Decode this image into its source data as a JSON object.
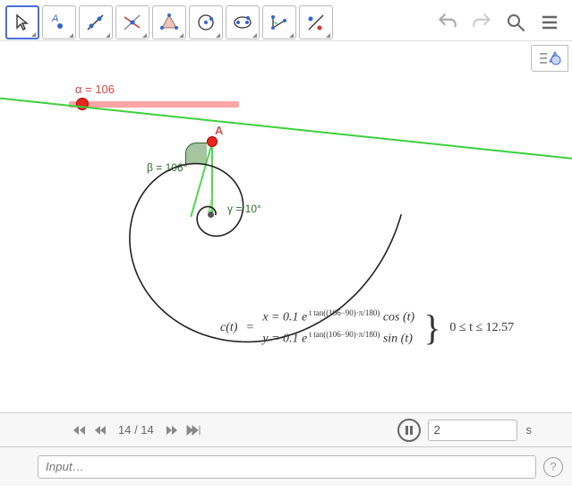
{
  "toolbar": {
    "tools": [
      {
        "name": "move-tool"
      },
      {
        "name": "point-tool"
      },
      {
        "name": "line-tool"
      },
      {
        "name": "perpendicular-tool"
      },
      {
        "name": "polygon-tool"
      },
      {
        "name": "circle-tool"
      },
      {
        "name": "ellipse-tool"
      },
      {
        "name": "angle-tool"
      },
      {
        "name": "reflect-tool"
      }
    ]
  },
  "slider": {
    "alpha_label": "α = 106"
  },
  "points": {
    "A_label": "A"
  },
  "angles": {
    "beta_label": "β = 106°",
    "gamma_label": "γ = 10°"
  },
  "formula": {
    "lhs": "c(t)",
    "eq": "=",
    "row1_pre": "x = 0.1 e",
    "row1_exp": " t tan((106−90)·π/180)",
    "row1_post": " cos (t)",
    "row2_pre": "y = 0.1 e",
    "row2_exp": " t tan((106−90)·π/180)",
    "row2_post": " sin (t)",
    "range": "0 ≤ t ≤ 12.57"
  },
  "nav": {
    "frame": "14 / 14",
    "speed_value": "2",
    "speed_unit": "s"
  },
  "input": {
    "placeholder": "Input…"
  },
  "colors": {
    "accent_red": "#e8261f",
    "accent_green": "#3bd13b",
    "dark_green": "#2e6b2e"
  },
  "chart_data": {
    "type": "parametric-curve",
    "title": "Equiangular spiral",
    "parameter": "t",
    "t_range": [
      0,
      12.57
    ],
    "alpha_deg": 106,
    "beta_deg": 106,
    "gamma_deg": 10,
    "x_of_t": "0.1 * e^(t * tan((106-90)*pi/180)) * cos(t)",
    "y_of_t": "0.1 * e^(t * tan((106-90)*pi/180)) * sin(t)"
  }
}
